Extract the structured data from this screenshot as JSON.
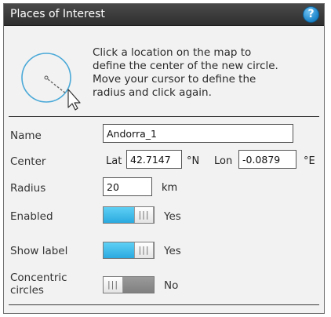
{
  "panel": {
    "title": "Places of Interest",
    "help_symbol": "?"
  },
  "intro": {
    "lines": [
      "Click a location on the map to",
      "define the center of the new circle.",
      "Move your cursor to define the",
      "radius and click again."
    ],
    "graphic_icon": "circle-drawing-cursor-icon"
  },
  "form": {
    "name_label": "Name",
    "name_value": "Andorra_1",
    "center_label": "Center",
    "lat_label": "Lat",
    "lat_value": "42.7147",
    "lat_unit": "°N",
    "lon_label": "Lon",
    "lon_value": "-0.0879",
    "lon_unit": "°E",
    "radius_label": "Radius",
    "radius_value": "20",
    "radius_unit": "km",
    "enabled_label": "Enabled",
    "enabled_state": "Yes",
    "show_label_label": "Show label",
    "show_label_state": "Yes",
    "concentric_label_line1": "Concentric",
    "concentric_label_line2": "circles",
    "concentric_state": "No"
  },
  "colors": {
    "title_bar": "#3a3a3a",
    "toggle_on": "#2aa9df",
    "toggle_off": "#808080",
    "help_button": "#1b84c9"
  }
}
